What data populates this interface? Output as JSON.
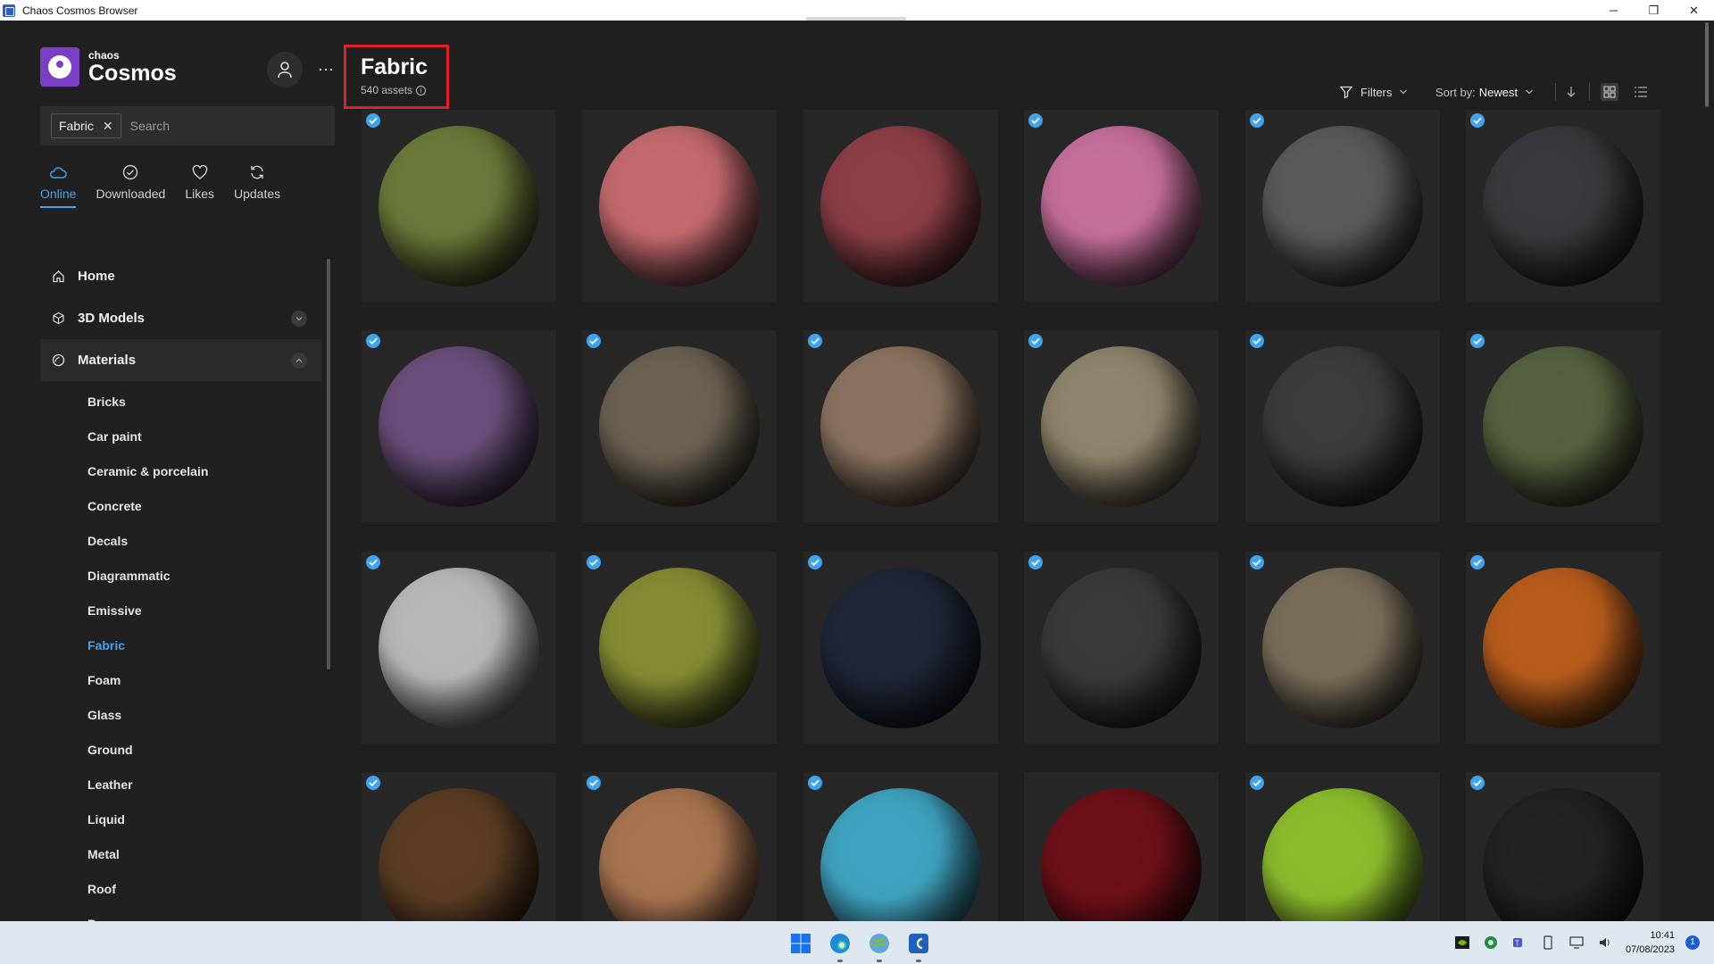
{
  "window": {
    "title": "Chaos Cosmos Browser",
    "controls": {
      "minimize": "─",
      "restore": "❐",
      "close": "✕"
    }
  },
  "brand": {
    "small": "chaos",
    "big": "Cosmos",
    "color": "#7b3fc6"
  },
  "header_icons": {
    "user": "user-icon",
    "more": "···"
  },
  "search": {
    "chip_label": "Fabric",
    "chip_remove": "✕",
    "placeholder": "Search"
  },
  "source_tabs": [
    {
      "label": "Online",
      "icon": "cloud-icon",
      "active": true
    },
    {
      "label": "Downloaded",
      "icon": "check-circle-icon",
      "active": false
    },
    {
      "label": "Likes",
      "icon": "heart-icon",
      "active": false
    },
    {
      "label": "Updates",
      "icon": "refresh-icon",
      "active": false
    }
  ],
  "nav": {
    "home": "Home",
    "models": "3D Models",
    "materials": "Materials",
    "sub_items": [
      "Bricks",
      "Car paint",
      "Ceramic & porcelain",
      "Concrete",
      "Decals",
      "Diagrammatic",
      "Emissive",
      "Fabric",
      "Foam",
      "Glass",
      "Ground",
      "Leather",
      "Liquid",
      "Metal",
      "Roof",
      "Paper"
    ],
    "active_sub": "Fabric"
  },
  "page": {
    "title": "Fabric",
    "count": "540 assets"
  },
  "toolbar": {
    "filters": "Filters",
    "sort_label": "Sort by:",
    "sort_value": "Newest"
  },
  "accent": "#3ea3f0",
  "assets": [
    {
      "checked": true,
      "color": "#6b7a3a"
    },
    {
      "checked": false,
      "color": "#c46a6f"
    },
    {
      "checked": false,
      "color": "#8c3f46"
    },
    {
      "checked": true,
      "color": "#c66f9c"
    },
    {
      "checked": true,
      "color": "#5a5a5a"
    },
    {
      "checked": true,
      "color": "#3a3a3e"
    },
    {
      "checked": true,
      "color": "#6a4f7a"
    },
    {
      "checked": true,
      "color": "#6c6252"
    },
    {
      "checked": true,
      "color": "#8b7360"
    },
    {
      "checked": true,
      "color": "#8f846c"
    },
    {
      "checked": true,
      "color": "#3c3c3c"
    },
    {
      "checked": true,
      "color": "#56623f"
    },
    {
      "checked": true,
      "color": "#b8b8b8"
    },
    {
      "checked": true,
      "color": "#868c34"
    },
    {
      "checked": true,
      "color": "#1f2738"
    },
    {
      "checked": true,
      "color": "#3a3a3a"
    },
    {
      "checked": true,
      "color": "#7a6e5a"
    },
    {
      "checked": true,
      "color": "#b85d1c"
    },
    {
      "checked": true,
      "color": "#5a3d24"
    },
    {
      "checked": true,
      "color": "#a87450"
    },
    {
      "checked": true,
      "color": "#3fa3bf"
    },
    {
      "checked": false,
      "color": "#6e1018"
    },
    {
      "checked": true,
      "color": "#8cbc2c"
    },
    {
      "checked": true,
      "color": "#222222"
    }
  ],
  "taskbar": {
    "time": "10:41",
    "date": "07/08/2023",
    "notifications": "1"
  }
}
